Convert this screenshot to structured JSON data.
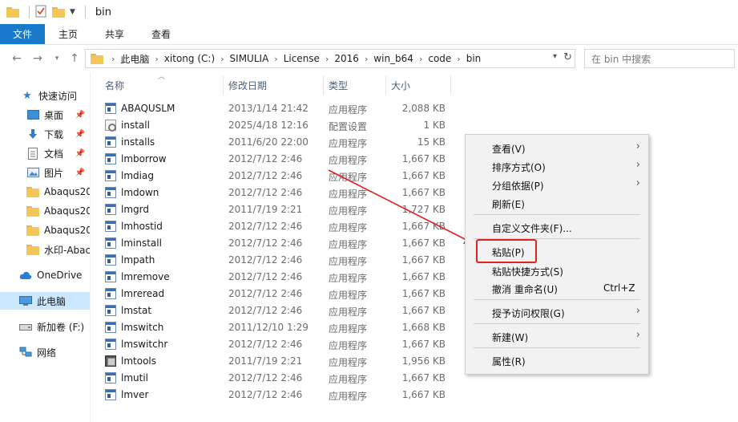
{
  "window": {
    "title": "bin"
  },
  "ribbon": {
    "tabs": [
      "文件",
      "主页",
      "共享",
      "查看"
    ]
  },
  "address": {
    "crumbs": [
      "此电脑",
      "xitong (C:)",
      "SIMULIA",
      "License",
      "2016",
      "win_b64",
      "code",
      "bin"
    ]
  },
  "search": {
    "placeholder": "在 bin 中搜索"
  },
  "navpane": {
    "quick_access": "快速访问",
    "items": [
      {
        "label": "桌面",
        "pinned": true
      },
      {
        "label": "下载",
        "pinned": true
      },
      {
        "label": "文档",
        "pinned": true
      },
      {
        "label": "图片",
        "pinned": true
      },
      {
        "label": "Abaqus20",
        "pinned": false
      },
      {
        "label": "Abaqus20",
        "pinned": false
      },
      {
        "label": "Abaqus20",
        "pinned": false
      },
      {
        "label": "水印-Abac",
        "pinned": false
      }
    ],
    "onedrive": "OneDrive",
    "this_pc": "此电脑",
    "drive": "新加卷 (F:)",
    "network": "网络"
  },
  "columns": {
    "name": "名称",
    "date": "修改日期",
    "type": "类型",
    "size": "大小"
  },
  "files": [
    {
      "name": "ABAQUSLM",
      "date": "2013/1/14 21:42",
      "type": "应用程序",
      "size": "2,088 KB",
      "icon": "exe"
    },
    {
      "name": "install",
      "date": "2025/4/18 12:16",
      "type": "配置设置",
      "size": "1 KB",
      "icon": "ini"
    },
    {
      "name": "installs",
      "date": "2011/6/20 22:00",
      "type": "应用程序",
      "size": "15 KB",
      "icon": "exe"
    },
    {
      "name": "lmborrow",
      "date": "2012/7/12 2:46",
      "type": "应用程序",
      "size": "1,667 KB",
      "icon": "exe"
    },
    {
      "name": "lmdiag",
      "date": "2012/7/12 2:46",
      "type": "应用程序",
      "size": "1,667 KB",
      "icon": "exe"
    },
    {
      "name": "lmdown",
      "date": "2012/7/12 2:46",
      "type": "应用程序",
      "size": "1,667 KB",
      "icon": "exe"
    },
    {
      "name": "lmgrd",
      "date": "2011/7/19 2:21",
      "type": "应用程序",
      "size": "1,727 KB",
      "icon": "exe"
    },
    {
      "name": "lmhostid",
      "date": "2012/7/12 2:46",
      "type": "应用程序",
      "size": "1,667 KB",
      "icon": "exe"
    },
    {
      "name": "lminstall",
      "date": "2012/7/12 2:46",
      "type": "应用程序",
      "size": "1,667 KB",
      "icon": "exe"
    },
    {
      "name": "lmpath",
      "date": "2012/7/12 2:46",
      "type": "应用程序",
      "size": "1,667 KB",
      "icon": "exe"
    },
    {
      "name": "lmremove",
      "date": "2012/7/12 2:46",
      "type": "应用程序",
      "size": "1,667 KB",
      "icon": "exe"
    },
    {
      "name": "lmreread",
      "date": "2012/7/12 2:46",
      "type": "应用程序",
      "size": "1,667 KB",
      "icon": "exe"
    },
    {
      "name": "lmstat",
      "date": "2012/7/12 2:46",
      "type": "应用程序",
      "size": "1,667 KB",
      "icon": "exe"
    },
    {
      "name": "lmswitch",
      "date": "2011/12/10 1:29",
      "type": "应用程序",
      "size": "1,668 KB",
      "icon": "exe"
    },
    {
      "name": "lmswitchr",
      "date": "2012/7/12 2:46",
      "type": "应用程序",
      "size": "1,667 KB",
      "icon": "exe"
    },
    {
      "name": "lmtools",
      "date": "2011/7/19 2:21",
      "type": "应用程序",
      "size": "1,956 KB",
      "icon": "tools"
    },
    {
      "name": "lmutil",
      "date": "2012/7/12 2:46",
      "type": "应用程序",
      "size": "1,667 KB",
      "icon": "exe"
    },
    {
      "name": "lmver",
      "date": "2012/7/12 2:46",
      "type": "应用程序",
      "size": "1,667 KB",
      "icon": "exe"
    }
  ],
  "context_menu": {
    "items": [
      {
        "label": "查看(V)",
        "submenu": true
      },
      {
        "label": "排序方式(O)",
        "submenu": true
      },
      {
        "label": "分组依据(P)",
        "submenu": true
      },
      {
        "label": "刷新(E)"
      },
      {
        "label": "自定义文件夹(F)..."
      },
      {
        "label": "粘贴(P)",
        "highlighted": true
      },
      {
        "label": "粘贴快捷方式(S)"
      },
      {
        "label": "撤消 重命名(U)",
        "shortcut": "Ctrl+Z"
      },
      {
        "label": "授予访问权限(G)",
        "submenu": true
      },
      {
        "label": "新建(W)",
        "submenu": true
      },
      {
        "label": "属性(R)"
      }
    ]
  },
  "colors": {
    "accent": "#1979ca",
    "annotation": "#e0231e",
    "selection": "#cce8ff"
  }
}
